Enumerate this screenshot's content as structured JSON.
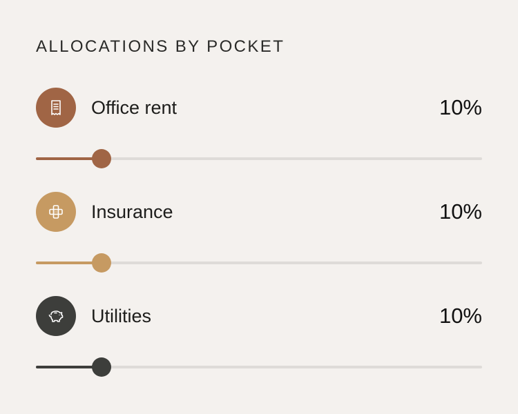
{
  "title": "ALLOCATIONS BY POCKET",
  "pockets": [
    {
      "name": "Office rent",
      "value_label": "10%",
      "percent": 10,
      "slider_position": 0.147,
      "icon": "receipt-icon",
      "color": "#a06545"
    },
    {
      "name": "Insurance",
      "value_label": "10%",
      "percent": 10,
      "slider_position": 0.147,
      "icon": "bandage-icon",
      "color": "#c69a62"
    },
    {
      "name": "Utilities",
      "value_label": "10%",
      "percent": 10,
      "slider_position": 0.147,
      "icon": "piggy-bank-icon",
      "color": "#3d3e3b"
    }
  ],
  "colors": {
    "background": "#f4f1ee",
    "track": "#dedbd8",
    "text": "#1d1d1b"
  }
}
